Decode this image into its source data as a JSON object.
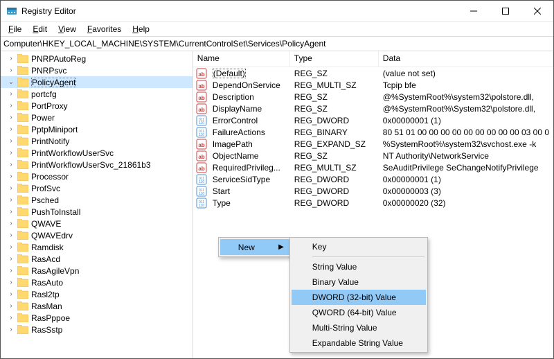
{
  "window": {
    "title": "Registry Editor"
  },
  "menu": {
    "file": "File",
    "edit": "Edit",
    "view": "View",
    "favorites": "Favorites",
    "help": "Help"
  },
  "address": {
    "value": "Computer\\HKEY_LOCAL_MACHINE\\SYSTEM\\CurrentControlSet\\Services\\PolicyAgent"
  },
  "tree": {
    "items": [
      {
        "label": "PNRPAutoReg",
        "selected": false
      },
      {
        "label": "PNRPsvc",
        "selected": false
      },
      {
        "label": "PolicyAgent",
        "selected": true
      },
      {
        "label": "portcfg",
        "selected": false
      },
      {
        "label": "PortProxy",
        "selected": false
      },
      {
        "label": "Power",
        "selected": false
      },
      {
        "label": "PptpMiniport",
        "selected": false
      },
      {
        "label": "PrintNotify",
        "selected": false
      },
      {
        "label": "PrintWorkflowUserSvc",
        "selected": false
      },
      {
        "label": "PrintWorkflowUserSvc_21861b3",
        "selected": false
      },
      {
        "label": "Processor",
        "selected": false
      },
      {
        "label": "ProfSvc",
        "selected": false
      },
      {
        "label": "Psched",
        "selected": false
      },
      {
        "label": "PushToInstall",
        "selected": false
      },
      {
        "label": "QWAVE",
        "selected": false
      },
      {
        "label": "QWAVEdrv",
        "selected": false
      },
      {
        "label": "Ramdisk",
        "selected": false
      },
      {
        "label": "RasAcd",
        "selected": false
      },
      {
        "label": "RasAgileVpn",
        "selected": false
      },
      {
        "label": "RasAuto",
        "selected": false
      },
      {
        "label": "Rasl2tp",
        "selected": false
      },
      {
        "label": "RasMan",
        "selected": false
      },
      {
        "label": "RasPppoe",
        "selected": false
      },
      {
        "label": "RasSstp",
        "selected": false
      }
    ]
  },
  "columns": {
    "name": "Name",
    "type": "Type",
    "data": "Data"
  },
  "values": [
    {
      "icon": "sz",
      "name": "(Default)",
      "type": "REG_SZ",
      "data": "(value not set)",
      "selected": true
    },
    {
      "icon": "sz",
      "name": "DependOnService",
      "type": "REG_MULTI_SZ",
      "data": "Tcpip bfe"
    },
    {
      "icon": "sz",
      "name": "Description",
      "type": "REG_SZ",
      "data": "@%SystemRoot%\\system32\\polstore.dll,"
    },
    {
      "icon": "sz",
      "name": "DisplayName",
      "type": "REG_SZ",
      "data": "@%SystemRoot%\\System32\\polstore.dll,"
    },
    {
      "icon": "bin",
      "name": "ErrorControl",
      "type": "REG_DWORD",
      "data": "0x00000001 (1)"
    },
    {
      "icon": "bin",
      "name": "FailureActions",
      "type": "REG_BINARY",
      "data": "80 51 01 00 00 00 00 00 00 00 00 00 03 00 0"
    },
    {
      "icon": "sz",
      "name": "ImagePath",
      "type": "REG_EXPAND_SZ",
      "data": "%SystemRoot%\\system32\\svchost.exe -k"
    },
    {
      "icon": "sz",
      "name": "ObjectName",
      "type": "REG_SZ",
      "data": "NT Authority\\NetworkService"
    },
    {
      "icon": "sz",
      "name": "RequiredPrivileg...",
      "type": "REG_MULTI_SZ",
      "data": "SeAuditPrivilege SeChangeNotifyPrivilege"
    },
    {
      "icon": "bin",
      "name": "ServiceSidType",
      "type": "REG_DWORD",
      "data": "0x00000001 (1)"
    },
    {
      "icon": "bin",
      "name": "Start",
      "type": "REG_DWORD",
      "data": "0x00000003 (3)"
    },
    {
      "icon": "bin",
      "name": "Type",
      "type": "REG_DWORD",
      "data": "0x00000020 (32)"
    }
  ],
  "context": {
    "parent_label": "New",
    "submenu": [
      {
        "label": "Key",
        "sep_after": true
      },
      {
        "label": "String Value"
      },
      {
        "label": "Binary Value"
      },
      {
        "label": "DWORD (32-bit) Value",
        "highlight": true
      },
      {
        "label": "QWORD (64-bit) Value"
      },
      {
        "label": "Multi-String Value"
      },
      {
        "label": "Expandable String Value"
      }
    ]
  }
}
